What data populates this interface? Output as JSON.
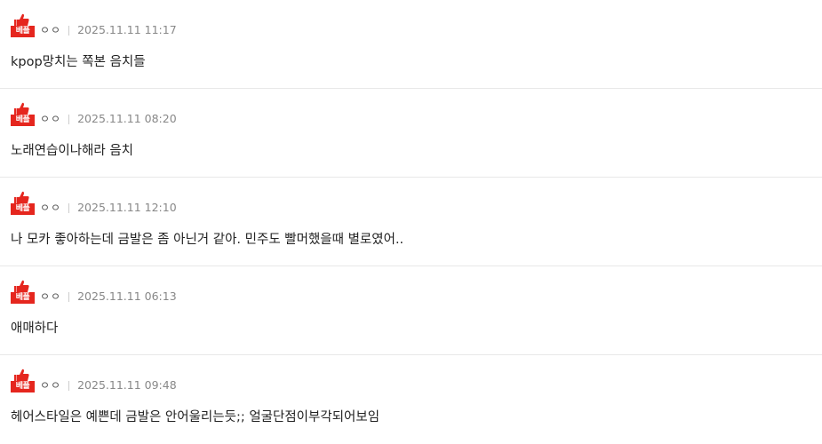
{
  "colors": {
    "badge_red": "#e5261e",
    "divider": "#e8e8e8",
    "date_gray": "#888888"
  },
  "comments": [
    {
      "badge": "베플",
      "badge_icon": "thumbs-up-icon",
      "author": "ㅇㅇ",
      "date": "2025.11.11 11:17",
      "text": "kpop망치는 쪽본 음치들"
    },
    {
      "badge": "베플",
      "badge_icon": "thumbs-up-icon",
      "author": "ㅇㅇ",
      "date": "2025.11.11 08:20",
      "text": "노래연습이나해라 음치"
    },
    {
      "badge": "베플",
      "badge_icon": "thumbs-up-icon",
      "author": "ㅇㅇ",
      "date": "2025.11.11 12:10",
      "text": "나 모카 좋아하는데 금발은 좀 아닌거 같아. 민주도 빨머했을때 별로였어.."
    },
    {
      "badge": "베플",
      "badge_icon": "thumbs-up-icon",
      "author": "ㅇㅇ",
      "date": "2025.11.11 06:13",
      "text": "애매하다"
    },
    {
      "badge": "베플",
      "badge_icon": "thumbs-up-icon",
      "author": "ㅇㅇ",
      "date": "2025.11.11 09:48",
      "text": "헤어스타일은 예쁜데 금발은 안어울리는듯;; 얼굴단점이부각되어보임"
    }
  ]
}
